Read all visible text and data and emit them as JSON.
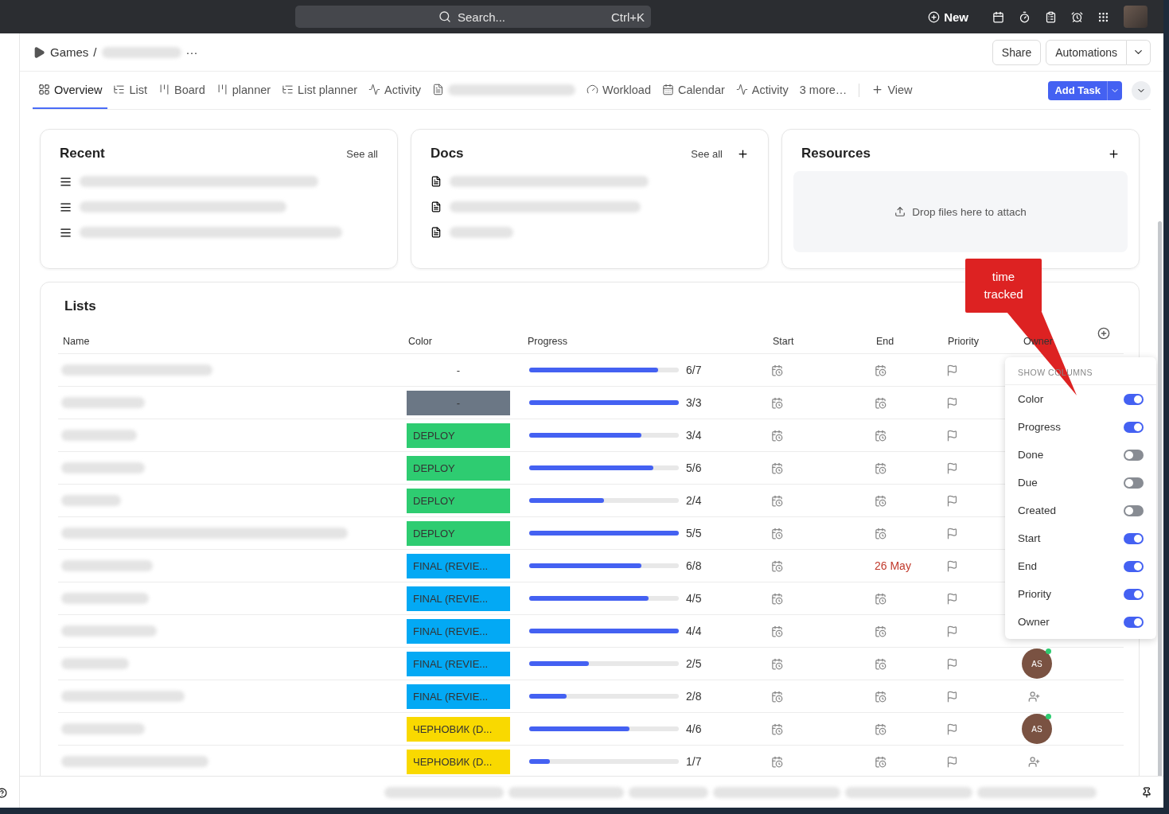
{
  "topbar": {
    "search": {
      "placeholder": "Search...",
      "shortcut": "Ctrl+K"
    },
    "new_label": "New"
  },
  "breadcrumb": {
    "space": "Games",
    "separator": "/",
    "more": "···"
  },
  "header_buttons": {
    "share": "Share",
    "automations": "Automations"
  },
  "tabs": [
    {
      "kind": "overview",
      "label": "Overview",
      "selected": true
    },
    {
      "kind": "list",
      "label": "List",
      "selected": false
    },
    {
      "kind": "board",
      "label": "Board",
      "selected": false
    },
    {
      "kind": "board",
      "label": "planner",
      "selected": false
    },
    {
      "kind": "list",
      "label": "List planner",
      "selected": false
    },
    {
      "kind": "activity",
      "label": "Activity",
      "selected": false
    },
    {
      "kind": "doc",
      "selected": false
    },
    {
      "kind": "workload",
      "label": "Workload",
      "selected": false
    },
    {
      "kind": "calendar",
      "label": "Calendar",
      "selected": false
    },
    {
      "kind": "activity",
      "label": "Activity",
      "selected": false
    },
    {
      "kind": "more",
      "label": "3 more…",
      "selected": false
    }
  ],
  "add_view": "View",
  "add_task": "Add Task",
  "recent": {
    "title": "Recent",
    "see_all": "See all"
  },
  "docs": {
    "title": "Docs",
    "see_all": "See all"
  },
  "resources": {
    "title": "Resources",
    "drop_hint": "Drop files here to attach"
  },
  "lists": {
    "title": "Lists",
    "columns": [
      "Name",
      "Color",
      "Progress",
      "Start",
      "End",
      "Priority",
      "Owner"
    ],
    "rows": [
      {
        "color_label": "-",
        "color": null,
        "level": 0.86,
        "progress": "6/7"
      },
      {
        "color_label": "-",
        "color": "#6b7785",
        "level": 1,
        "progress": "3/3"
      },
      {
        "color_label": "DEPLOY",
        "color": "#2ecc71",
        "level": 0.75,
        "progress": "3/4"
      },
      {
        "color_label": "DEPLOY",
        "color": "#2ecc71",
        "level": 0.83,
        "progress": "5/6"
      },
      {
        "color_label": "DEPLOY",
        "color": "#2ecc71",
        "level": 0.5,
        "progress": "2/4"
      },
      {
        "color_label": "DEPLOY",
        "color": "#2ecc71",
        "level": 1,
        "progress": "5/5"
      },
      {
        "color_label": "FINAL (REVIE...",
        "color": "#03a9f4",
        "level": 0.75,
        "progress": "6/8",
        "end": "26 May"
      },
      {
        "color_label": "FINAL (REVIE...",
        "color": "#03a9f4",
        "level": 0.8,
        "progress": "4/5"
      },
      {
        "color_label": "FINAL (REVIE...",
        "color": "#03a9f4",
        "level": 1,
        "progress": "4/4"
      },
      {
        "color_label": "FINAL (REVIE...",
        "color": "#03a9f4",
        "level": 0.4,
        "progress": "2/5",
        "owner": {
          "kind": "avatar",
          "initials": "AS",
          "online": true
        }
      },
      {
        "color_label": "FINAL (REVIE...",
        "color": "#03a9f4",
        "level": 0.25,
        "progress": "2/8",
        "owner": {
          "kind": "add"
        }
      },
      {
        "color_label": "ЧЕРНОВИК (D...",
        "color": "#f9d900",
        "level": 0.67,
        "progress": "4/6",
        "owner": {
          "kind": "avatar",
          "initials": "AS",
          "online": true
        }
      },
      {
        "color_label": "ЧЕРНОВИК (D...",
        "color": "#f9d900",
        "level": 0.14,
        "progress": "1/7",
        "owner": {
          "kind": "add"
        }
      }
    ]
  },
  "show_columns": {
    "title": "SHOW COLUMNS",
    "items": [
      {
        "label": "Color",
        "on": true
      },
      {
        "label": "Progress",
        "on": true
      },
      {
        "label": "Done",
        "on": false
      },
      {
        "label": "Due",
        "on": false
      },
      {
        "label": "Created",
        "on": false
      },
      {
        "label": "Start",
        "on": true
      },
      {
        "label": "End",
        "on": true
      },
      {
        "label": "Priority",
        "on": true
      },
      {
        "label": "Owner",
        "on": true
      }
    ]
  },
  "callout": {
    "text": "time tracked"
  }
}
